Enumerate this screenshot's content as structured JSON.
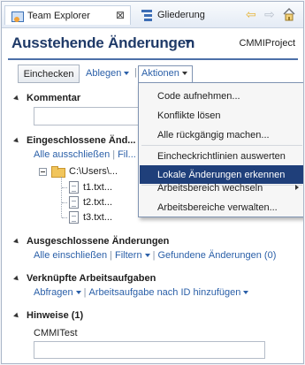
{
  "tabs": {
    "active_label": "Team Explorer",
    "close_glyph": "⊠",
    "other_label": "Gliederung"
  },
  "nav": {
    "back_glyph": "⇦",
    "forward_glyph": "⇨"
  },
  "header": {
    "title": "Ausstehende Änderungen",
    "project": "CMMIProject"
  },
  "toolbar": {
    "checkin_label": "Einchecken",
    "shelve_label": "Ablegen",
    "separator": "|",
    "actions_label": "Aktionen"
  },
  "sections": {
    "comment": {
      "title": "Kommentar"
    },
    "included": {
      "title": "Eingeschlossene Änd...",
      "links": [
        "Alle ausschließen",
        "Fil..."
      ],
      "folder": "C:\\Users\\...",
      "files": [
        "t1.txt...",
        "t2.txt...",
        "t3.txt..."
      ]
    },
    "excluded": {
      "title": "Ausgeschlossene Änderungen",
      "links": [
        "Alle einschließen",
        "Filtern",
        "Gefundene Änderungen (0)"
      ]
    },
    "workitems": {
      "title": "Verknüpfte Arbeitsaufgaben",
      "links": [
        "Abfragen",
        "Arbeitsaufgabe nach ID hinzufügen"
      ]
    },
    "notes": {
      "title": "Hinweise (1)",
      "field_label": "CMMITest"
    }
  },
  "actions_menu": {
    "items": [
      "Code aufnehmen...",
      "Konflikte lösen",
      "Alle rückgängig machen...",
      "Eincheckrichtlinien auswerten",
      "Lokale Änderungen erkennen",
      "Arbeitsbereich wechseln",
      "Arbeitsbereiche verwalten..."
    ],
    "highlighted_index": 4
  },
  "colors": {
    "title": "#1f3a68",
    "link": "#2a5fa8",
    "menu_highlight": "#1f3f7a",
    "folder": "#f1c55c"
  }
}
